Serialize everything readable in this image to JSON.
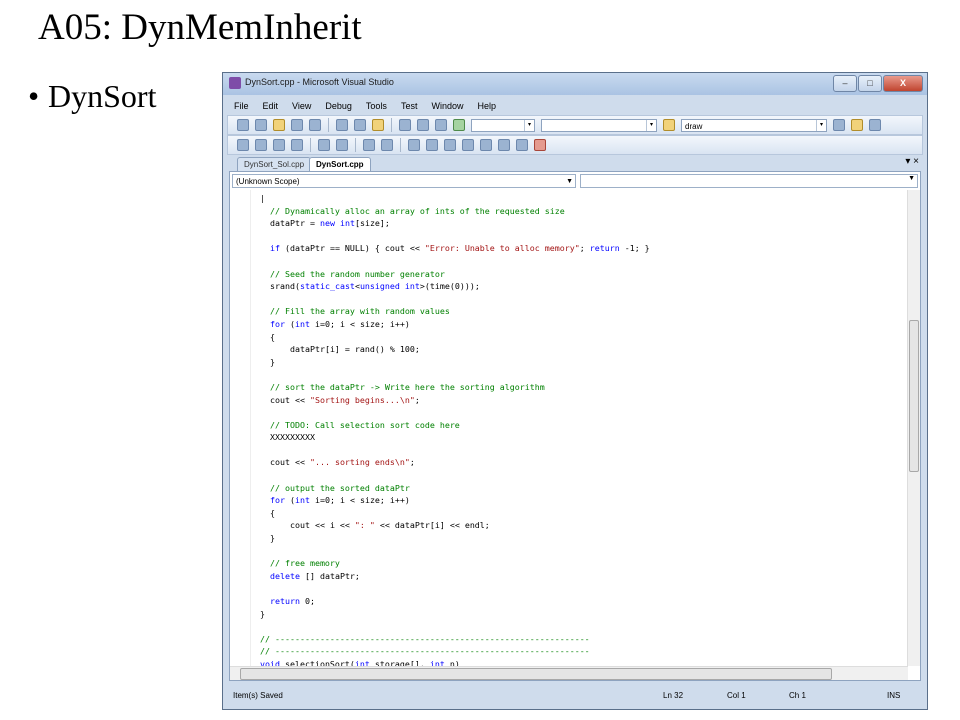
{
  "slide": {
    "title": "A05: DynMemInherit",
    "bullet": "DynSort"
  },
  "window": {
    "title": "DynSort.cpp - Microsoft Visual Studio",
    "min": "–",
    "max": "□",
    "close": "X"
  },
  "menu": [
    "File",
    "Edit",
    "View",
    "Debug",
    "Tools",
    "Test",
    "Window",
    "Help"
  ],
  "toolbar": {
    "search_value": "draw"
  },
  "tabs": [
    {
      "label": "DynSort_Sol.cpp",
      "active": false
    },
    {
      "label": "DynSort.cpp",
      "active": true
    }
  ],
  "tab_controls": "▾ ×",
  "editor": {
    "scope": "(Unknown Scope)",
    "lines": [
      "|",
      "// Dynamically alloc an array of ints of the requested size",
      "dataPtr = new int[size];",
      "",
      "if (dataPtr == NULL) { cout << \"Error: Unable to alloc memory\"; return -1; }",
      "",
      "// Seed the random number generator",
      "srand(static_cast<unsigned int>(time(0)));",
      "",
      "// Fill the array with random values",
      "for (int i=0; i < size; i++)",
      "{",
      "    dataPtr[i] = rand() % 100;",
      "}",
      "",
      "// sort the dataPtr -> Write here the sorting algorithm",
      "cout << \"Sorting begins...\\n\";",
      "",
      "// TODO: Call selection sort code here",
      "XXXXXXXXX",
      "",
      "cout << \"... sorting ends\\n\";",
      "",
      "// output the sorted dataPtr",
      "for (int i=0; i < size; i++)",
      "{",
      "    cout << i << \": \" << dataPtr[i] << endl;",
      "}",
      "",
      "// free memory",
      "delete [] dataPtr;",
      "",
      "return 0;",
      "}",
      "",
      "// ---------------------------------------------------------------",
      "// ---------------------------------------------------------------",
      "void selectionSort(int storage[], int n)"
    ]
  },
  "status": {
    "message": "Item(s) Saved",
    "ln": "Ln 32",
    "col": "Col 1",
    "ch": "Ch 1",
    "mode": "INS"
  }
}
